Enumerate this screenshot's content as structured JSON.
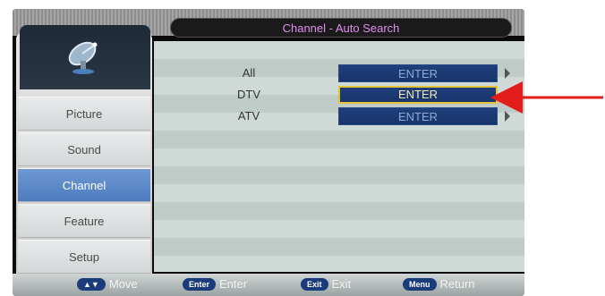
{
  "title": "Channel - Auto Search",
  "menu": {
    "items": [
      {
        "label": "Picture",
        "active": false
      },
      {
        "label": "Sound",
        "active": false
      },
      {
        "label": "Channel",
        "active": true
      },
      {
        "label": "Feature",
        "active": false
      },
      {
        "label": "Setup",
        "active": false
      }
    ]
  },
  "rows": [
    {
      "label": "All",
      "button": "ENTER",
      "selected": false
    },
    {
      "label": "DTV",
      "button": "ENTER",
      "selected": true
    },
    {
      "label": "ATV",
      "button": "ENTER",
      "selected": false
    }
  ],
  "footer": {
    "move": {
      "key": "▲▼",
      "label": "Move"
    },
    "enter": {
      "key": "Enter",
      "label": "Enter"
    },
    "exit": {
      "key": "Exit",
      "label": "Exit"
    },
    "return": {
      "key": "Menu",
      "label": "Return"
    }
  },
  "colors": {
    "title_text": "#e28ef0",
    "active_menu": "#5a88c8",
    "button_bg": "#1f3f7c",
    "selected_border": "#e5c23a",
    "annotation_arrow": "#e21b1b"
  },
  "icons": {
    "logo": "satellite-dish-icon",
    "annotation": "red-arrow-icon"
  }
}
